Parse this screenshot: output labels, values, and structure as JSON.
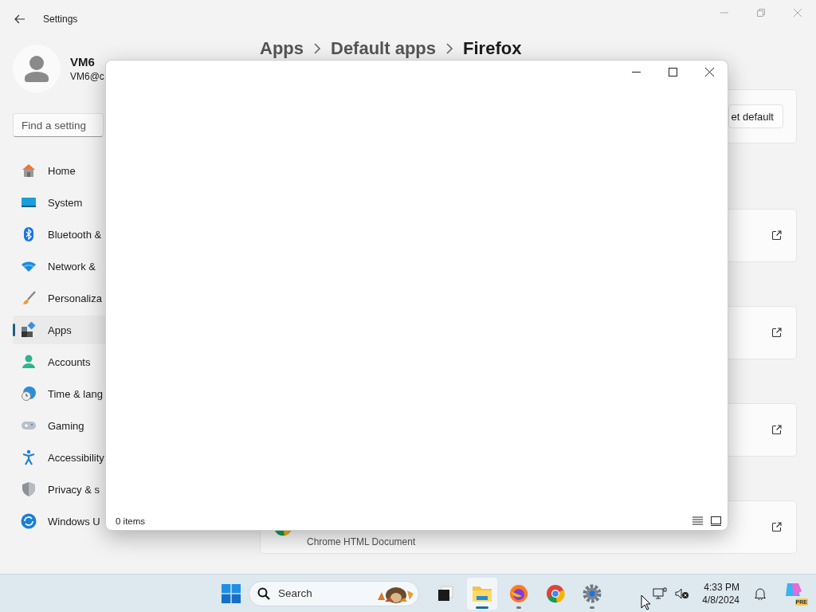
{
  "window": {
    "title": "Settings"
  },
  "user": {
    "name": "VM6",
    "email": "VM6@c"
  },
  "search": {
    "placeholder": "Find a setting"
  },
  "sidebar": {
    "items": [
      {
        "label": "Home",
        "kind": "home",
        "selected": false
      },
      {
        "label": "System",
        "kind": "system",
        "selected": false
      },
      {
        "label": "Bluetooth &",
        "kind": "bluetooth",
        "selected": false
      },
      {
        "label": "Network &",
        "kind": "network",
        "selected": false
      },
      {
        "label": "Personaliza",
        "kind": "brush",
        "selected": false
      },
      {
        "label": "Apps",
        "kind": "apps",
        "selected": true
      },
      {
        "label": "Accounts",
        "kind": "accounts",
        "selected": false
      },
      {
        "label": "Time & lang",
        "kind": "time",
        "selected": false
      },
      {
        "label": "Gaming",
        "kind": "gaming",
        "selected": false
      },
      {
        "label": "Accessibility",
        "kind": "accessibility",
        "selected": false
      },
      {
        "label": "Privacy & s",
        "kind": "privacy",
        "selected": false
      },
      {
        "label": "Windows U",
        "kind": "update",
        "selected": false
      }
    ]
  },
  "breadcrumb": [
    "Apps",
    "Default apps",
    "Firefox"
  ],
  "cards": [
    {
      "kind": "button",
      "button": "et default"
    },
    {
      "kind": "link"
    },
    {
      "kind": "link"
    },
    {
      "kind": "link"
    },
    {
      "kind": "app",
      "subtitle": "Chrome HTML Document"
    }
  ],
  "dialog": {
    "status": "0 items",
    "views": [
      {
        "kind": "details"
      },
      {
        "kind": "tiles"
      }
    ]
  },
  "taskbar": {
    "search_placeholder": "Search",
    "apps": [
      {
        "kind": "taskview",
        "active": false,
        "running": false
      },
      {
        "kind": "explorer",
        "active": true,
        "running": true
      },
      {
        "kind": "firefox",
        "active": false,
        "running": true
      },
      {
        "kind": "chrome",
        "active": false,
        "running": false
      },
      {
        "kind": "settings",
        "active": false,
        "running": true
      }
    ],
    "time": "4:33 PM",
    "date": "4/8/2024",
    "copilot_badge": "PRE"
  }
}
